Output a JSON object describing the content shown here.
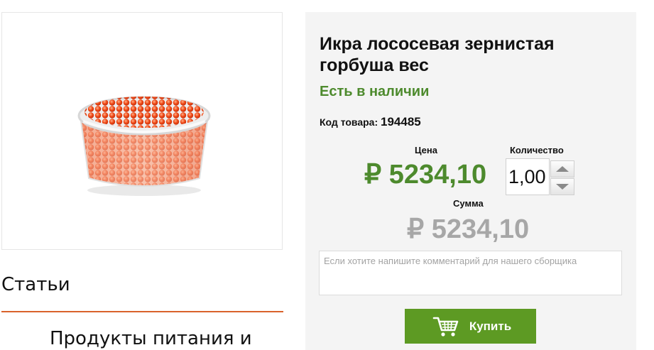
{
  "product": {
    "title": "Икра лососевая зернистая горбуша вес",
    "availability": "Есть в наличии",
    "sku_label": "Код товара:",
    "sku_value": "194485",
    "image_alt": "Икра лососевая зернистая горбуша вес"
  },
  "pricing": {
    "price_label": "Цена",
    "price_value": "₽ 5234,10",
    "quantity_label": "Количество",
    "quantity_value": "1,00",
    "total_label": "Сумма",
    "total_value": "₽ 5234,10"
  },
  "comment": {
    "placeholder": "Если хотите напишите комментарий для нашего сборщика"
  },
  "buy_button": {
    "label": "Купить",
    "icon": "cart-icon"
  },
  "articles": {
    "title": "Статьи",
    "first_item": "Продукты питания и"
  },
  "colors": {
    "accent_green": "#4d8a2d",
    "button_green": "#5d9a23",
    "divider_orange": "#d9622b",
    "muted_price": "#a7a7a7"
  }
}
